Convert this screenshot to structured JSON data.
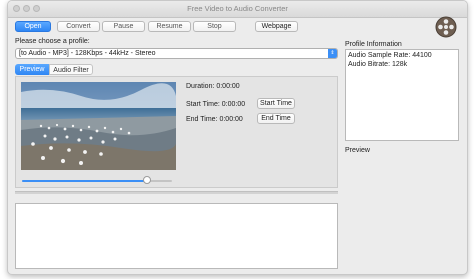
{
  "window": {
    "title": "Free Video to Audio Converter"
  },
  "toolbar": {
    "open": "Open",
    "convert": "Convert",
    "pause": "Pause",
    "resume": "Resume",
    "stop": "Stop",
    "webpage": "Webpage"
  },
  "profile": {
    "label": "Please choose a profile:",
    "selected": "[to Audio - MP3] - 128Kbps - 44kHz - Stereo"
  },
  "tabs": [
    {
      "label": "Preview"
    },
    {
      "label": "Audio Filter"
    }
  ],
  "preview": {
    "duration_label": "Duration: 0:00:00",
    "start_label": "Start Time: 0:00:00",
    "start_button": "Start Time",
    "end_label": "End Time: 0:00:00",
    "end_button": "End Time",
    "slider_value": 0.85
  },
  "info": {
    "title": "Profile Information",
    "lines": [
      "Audio Sample Rate: 44100",
      "Audio Bitrate: 128k"
    ],
    "preview_label": "Preview"
  },
  "icons": {
    "reel": "film-reel-icon",
    "dropdown": "chevron-updown-icon"
  },
  "colors": {
    "accent": "#2f86f4",
    "window_bg": "#ececec"
  }
}
